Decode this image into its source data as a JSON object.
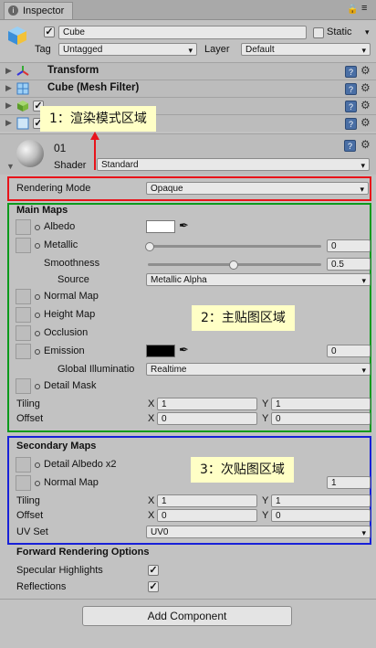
{
  "window": {
    "tab_title": "Inspector",
    "lock_icon": "lock-icon",
    "menu_icon": "menu-icon"
  },
  "object": {
    "name": "Cube",
    "active": true,
    "static_label": "Static",
    "static_checked": false,
    "tag_label": "Tag",
    "tag_value": "Untagged",
    "layer_label": "Layer",
    "layer_value": "Default"
  },
  "components": [
    {
      "name": "Transform",
      "icon": "transform-icon"
    },
    {
      "name": "Cube (Mesh Filter)",
      "icon": "mesh-filter-icon"
    },
    {
      "name": "",
      "icon": "mesh-renderer-icon"
    },
    {
      "name": "",
      "icon": "box-collider-icon"
    }
  ],
  "material": {
    "name": "01",
    "shader_label": "Shader",
    "shader_value": "Standard"
  },
  "rendering": {
    "label": "Rendering Mode",
    "value": "Opaque"
  },
  "main_maps": {
    "header": "Main Maps",
    "albedo": "Albedo",
    "albedo_color": "#ffffff",
    "metallic": "Metallic",
    "metallic_value": "0",
    "smoothness": "Smoothness",
    "smoothness_value": "0.5",
    "source": "Source",
    "source_value": "Metallic Alpha",
    "normal_map": "Normal Map",
    "height_map": "Height Map",
    "occlusion": "Occlusion",
    "emission": "Emission",
    "emission_color": "#000000",
    "emission_value": "0",
    "gi_label": "Global Illuminatio",
    "gi_value": "Realtime",
    "detail_mask": "Detail Mask",
    "tiling": "Tiling",
    "tiling_x": "1",
    "tiling_y": "1",
    "offset": "Offset",
    "offset_x": "0",
    "offset_y": "0",
    "x": "X",
    "y": "Y"
  },
  "secondary_maps": {
    "header": "Secondary Maps",
    "detail_albedo": "Detail Albedo x2",
    "normal_map": "Normal Map",
    "normal_value": "1",
    "tiling": "Tiling",
    "tiling_x": "1",
    "tiling_y": "1",
    "offset": "Offset",
    "offset_x": "0",
    "offset_y": "0",
    "uv_set": "UV Set",
    "uv_set_value": "UV0",
    "x": "X",
    "y": "Y"
  },
  "forward": {
    "header": "Forward Rendering Options",
    "specular": "Specular Highlights",
    "specular_checked": true,
    "reflections": "Reflections",
    "reflections_checked": true
  },
  "add_component": "Add Component",
  "annotations": {
    "one": "1：渲染模式区域",
    "two": "2：主贴图区域",
    "three": "3：次贴图区域"
  },
  "colors": {
    "red_box": "#e8131a",
    "green_box": "#0c9a1c",
    "blue_box": "#1820d8"
  }
}
